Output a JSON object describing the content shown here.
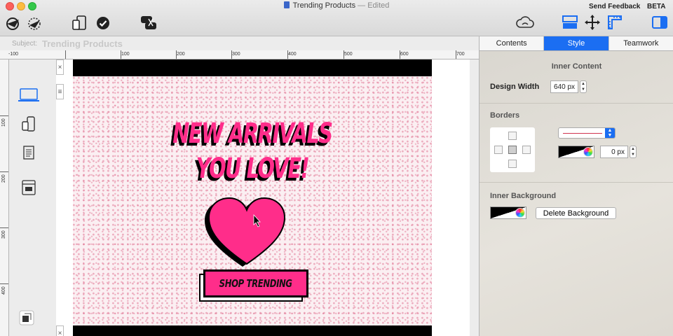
{
  "window": {
    "title": "Trending Products",
    "edited_suffix": " — Edited",
    "send_feedback": "Send Feedback",
    "beta": "BETA"
  },
  "toolbar": {
    "icons": [
      "send-icon",
      "speed-icon",
      "devices-icon",
      "check-icon",
      "chat-icon",
      "cloud-icon",
      "layout-icon",
      "move-icon",
      "ruler-icon",
      "sidebar-icon"
    ]
  },
  "subject": {
    "label": "Subject:",
    "value": "Trending Products"
  },
  "ruler": {
    "h_labels": [
      "-100",
      "100",
      "200",
      "300",
      "400",
      "500",
      "600",
      "700"
    ],
    "v_labels": [
      "100",
      "200",
      "300",
      "400"
    ]
  },
  "canvas": {
    "headline_line1": "NEW ARRIVALS",
    "headline_line2": "YOU LOVE!",
    "cta_label": "SHOP TRENDING",
    "colors": {
      "accent": "#ff2d8a",
      "bg": "#fbeff2",
      "ink": "#000000"
    }
  },
  "inspector": {
    "tabs": [
      {
        "label": "Contents"
      },
      {
        "label": "Style",
        "active": true
      },
      {
        "label": "Teamwork"
      }
    ],
    "inner_content": {
      "title": "Inner Content",
      "design_width_label": "Design Width",
      "design_width_value": "640 px"
    },
    "borders": {
      "title": "Borders",
      "width_value": "0 px"
    },
    "inner_background": {
      "title": "Inner Background",
      "delete_label": "Delete Background"
    },
    "accent": "#1b6ef2"
  }
}
